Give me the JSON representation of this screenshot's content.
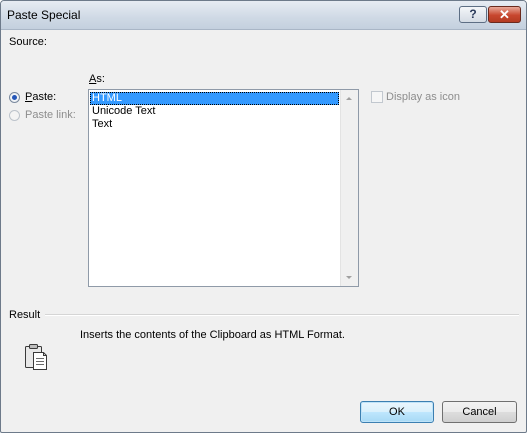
{
  "window": {
    "title": "Paste Special",
    "help_label": "?",
    "close_label": "✕"
  },
  "source": {
    "label": "Source:"
  },
  "paste_options": {
    "paste": {
      "label_key": "P",
      "label_rest": "aste:",
      "selected": true
    },
    "paste_link": {
      "label": "Paste link:",
      "enabled": false
    }
  },
  "as": {
    "label_key": "A",
    "label_rest": "s:",
    "items": [
      "HTML",
      "Unicode Text",
      "Text"
    ],
    "selected_index": 0
  },
  "display_as_icon": {
    "label": "Display as icon",
    "checked": false,
    "enabled": false
  },
  "result": {
    "label": "Result",
    "description": "Inserts the contents of the Clipboard as HTML Format.",
    "icon": "clipboard-icon"
  },
  "buttons": {
    "ok": "OK",
    "cancel": "Cancel"
  },
  "colors": {
    "selection": "#3399ff",
    "radio_dot": "#2556b8",
    "ok_border": "#3c7fb1"
  }
}
